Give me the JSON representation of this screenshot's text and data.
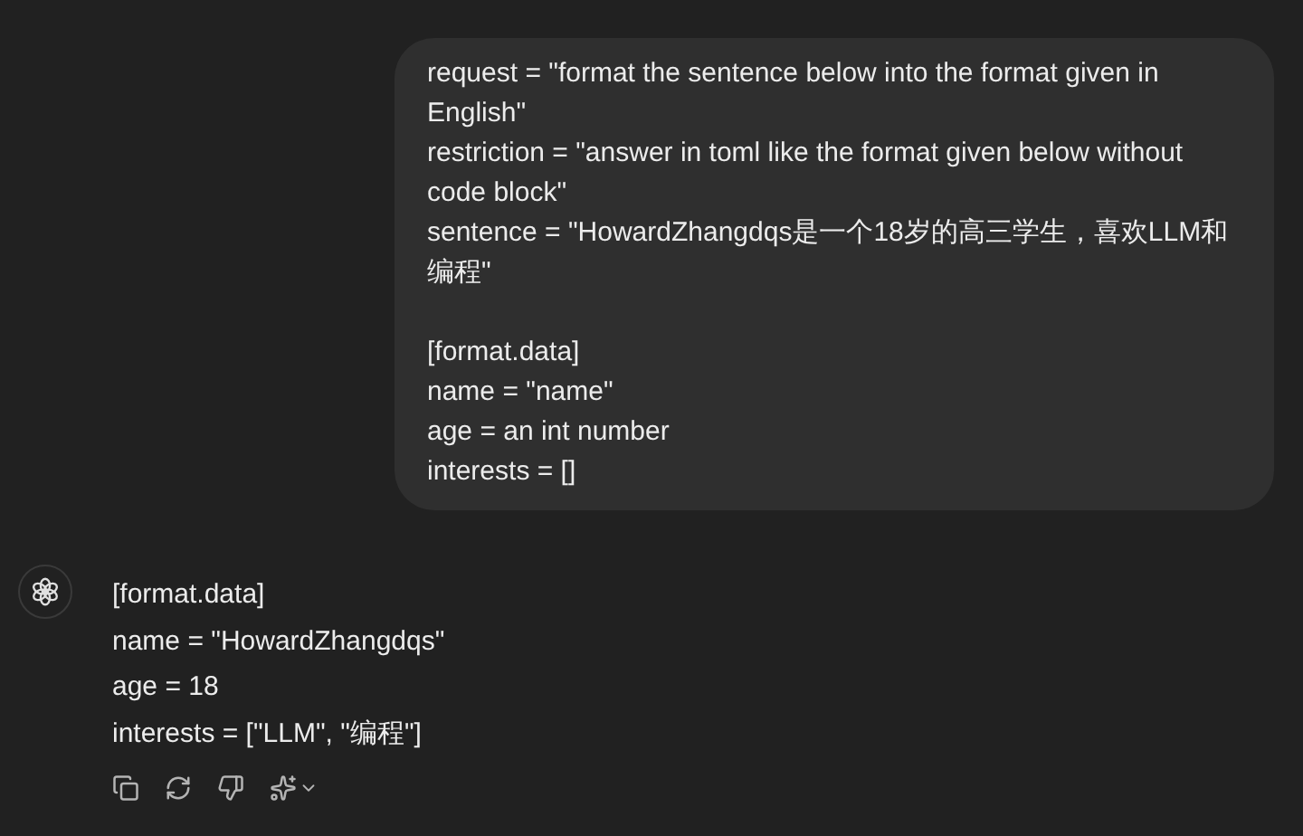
{
  "user_message": {
    "blocks": [
      [
        "request = \"format the sentence below into the format given in English\"",
        "restriction = \"answer in toml like the format given below without code block\"",
        "sentence = \"HowardZhangdqs是一个18岁的高三学生，喜欢LLM和编程\""
      ],
      [
        "[format.data]",
        "name = \"name\"",
        "age = an int number",
        "interests = []"
      ]
    ]
  },
  "assistant_message": {
    "lines": [
      "[format.data]",
      "name = \"HowardZhangdqs\"",
      "age = 18",
      "interests = [\"LLM\", \"编程\"]"
    ],
    "actions": [
      {
        "kind": "copy"
      },
      {
        "kind": "regenerate"
      },
      {
        "kind": "dislike"
      },
      {
        "kind": "model"
      }
    ]
  }
}
